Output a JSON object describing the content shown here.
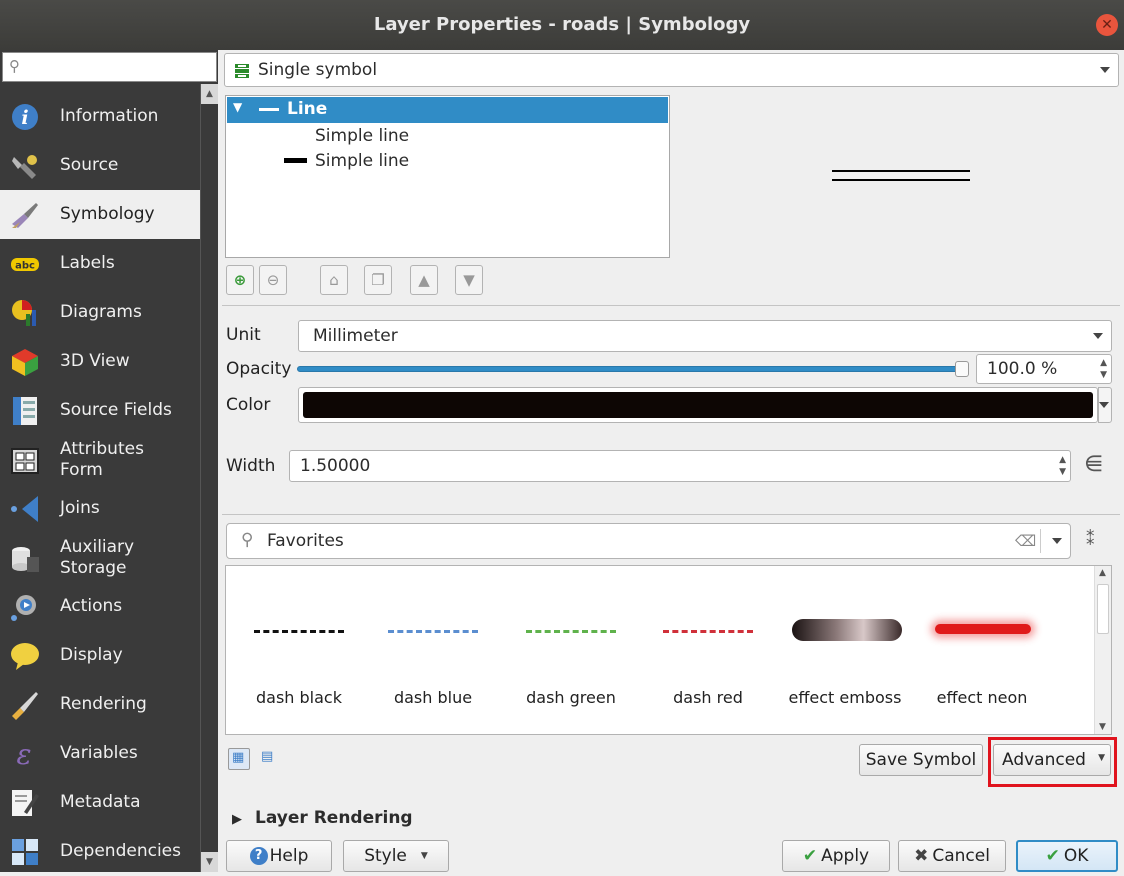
{
  "window": {
    "title": "Layer Properties - roads | Symbology"
  },
  "sidebar": {
    "search_placeholder": "",
    "items": [
      {
        "label": "Information",
        "icon": "info-icon"
      },
      {
        "label": "Source",
        "icon": "source-wrench-icon"
      },
      {
        "label": "Symbology",
        "icon": "symbology-brush-icon",
        "active": true
      },
      {
        "label": "Labels",
        "icon": "labels-abc-icon"
      },
      {
        "label": "Diagrams",
        "icon": "diagrams-icon"
      },
      {
        "label": "3D View",
        "icon": "3d-view-cube-icon"
      },
      {
        "label": "Source Fields",
        "icon": "source-fields-icon"
      },
      {
        "label": "Attributes\nForm",
        "icon": "attributes-form-icon"
      },
      {
        "label": "Joins",
        "icon": "joins-icon"
      },
      {
        "label": "Auxiliary\nStorage",
        "icon": "auxiliary-storage-icon"
      },
      {
        "label": "Actions",
        "icon": "actions-gear-icon"
      },
      {
        "label": "Display",
        "icon": "display-bubble-icon"
      },
      {
        "label": "Rendering",
        "icon": "rendering-brush-icon"
      },
      {
        "label": "Variables",
        "icon": "variables-epsilon-icon"
      },
      {
        "label": "Metadata",
        "icon": "metadata-pencil-icon"
      },
      {
        "label": "Dependencies",
        "icon": "dependencies-icon"
      }
    ]
  },
  "renderer": {
    "selected": "Single symbol"
  },
  "tree": {
    "root": "Line",
    "children": [
      "Simple line",
      "Simple line"
    ]
  },
  "props": {
    "unit_label": "Unit",
    "unit_value": "Millimeter",
    "opacity_label": "Opacity",
    "opacity_value": "100.0 %",
    "opacity_level": 1.0,
    "color_label": "Color",
    "color_value": "#0d0604",
    "width_label": "Width",
    "width_value": "1.50000"
  },
  "library": {
    "filter_value": "Favorites",
    "symbols": [
      {
        "name": "dash  black",
        "color": "#111111"
      },
      {
        "name": "dash blue",
        "color": "#5b8ed0"
      },
      {
        "name": "dash green",
        "color": "#5fb24c"
      },
      {
        "name": "dash red",
        "color": "#d0303a"
      },
      {
        "name": "effect emboss",
        "color": "#7a6a6a"
      },
      {
        "name": "effect neon",
        "color": "#e01a1a"
      }
    ]
  },
  "buttons": {
    "save_symbol": "Save Symbol",
    "advanced": "Advanced",
    "help": "Help",
    "style": "Style",
    "apply": "Apply",
    "cancel": "Cancel",
    "ok": "OK"
  },
  "section": {
    "layer_rendering": "Layer Rendering"
  },
  "colors": {
    "highlight": "#308cc6",
    "advanced_outline": "#e0131d"
  }
}
